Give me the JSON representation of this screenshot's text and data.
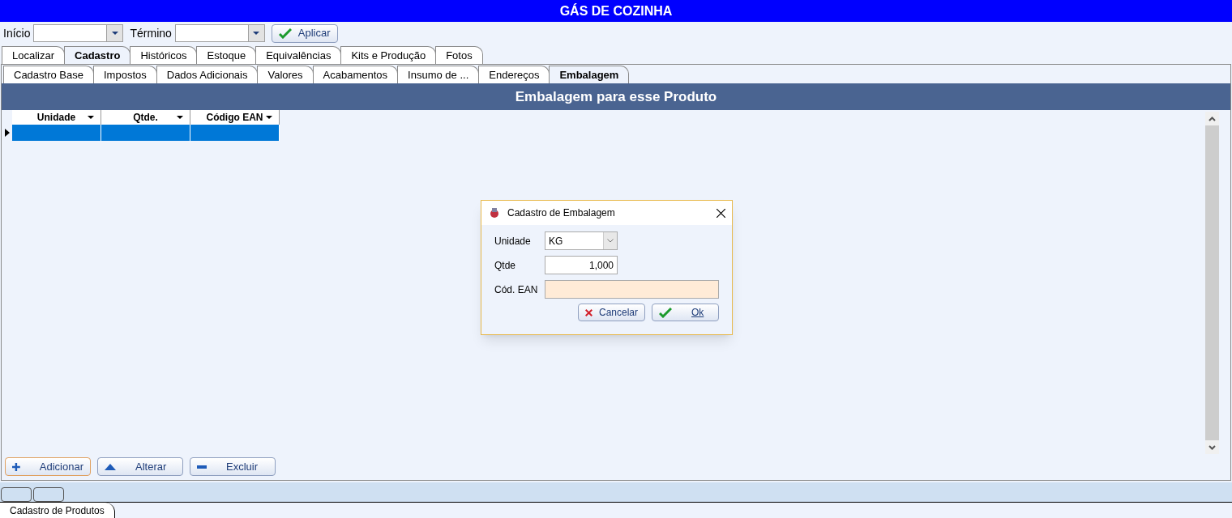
{
  "title": "GÁS DE COZINHA",
  "filters": [
    {
      "label": "Início"
    },
    {
      "label": "Término"
    }
  ],
  "apply_button": "Aplicar",
  "main_tabs": [
    {
      "label": "Localizar",
      "selected": false
    },
    {
      "label": "Cadastro",
      "selected": true
    },
    {
      "label": "Históricos",
      "selected": false
    },
    {
      "label": "Estoque",
      "selected": false
    },
    {
      "label": "Equivalências",
      "selected": false
    },
    {
      "label": "Kits e Produção",
      "selected": false
    },
    {
      "label": "Fotos",
      "selected": false
    }
  ],
  "sub_tabs": [
    {
      "label": "Cadastro Base",
      "selected": false
    },
    {
      "label": "Impostos",
      "selected": false
    },
    {
      "label": "Dados Adicionais",
      "selected": false
    },
    {
      "label": "Valores",
      "selected": false
    },
    {
      "label": "Acabamentos",
      "selected": false
    },
    {
      "label": "Insumo de ...",
      "selected": false
    },
    {
      "label": "Endereços",
      "selected": false
    },
    {
      "label": "Embalagem",
      "selected": true
    }
  ],
  "panel_title": "Embalagem para esse Produto",
  "grid": {
    "columns": [
      "Unidade",
      "Qtde.",
      "Código EAN"
    ],
    "rows": [
      {
        "selected": true
      }
    ]
  },
  "actions": [
    {
      "label": "Adicionar",
      "kind": "add",
      "focused": true
    },
    {
      "label": "Alterar",
      "kind": "edit",
      "focused": false
    },
    {
      "label": "Excluir",
      "kind": "delete",
      "focused": false
    }
  ],
  "bottom_tabs": [
    {
      "label": "Cadastro de Produtos",
      "selected": true
    }
  ],
  "dialog": {
    "title": "Cadastro de Embalagem",
    "fields": [
      {
        "label": "Unidade",
        "value": "KG",
        "kind": "select"
      },
      {
        "label": "Qtde",
        "value": "1,000",
        "kind": "number"
      },
      {
        "label": "Cód. EAN",
        "kind": "text"
      }
    ],
    "buttons": [
      {
        "label": "Cancelar",
        "kind": "cancel"
      },
      {
        "label": "Ok",
        "kind": "ok"
      }
    ]
  }
}
